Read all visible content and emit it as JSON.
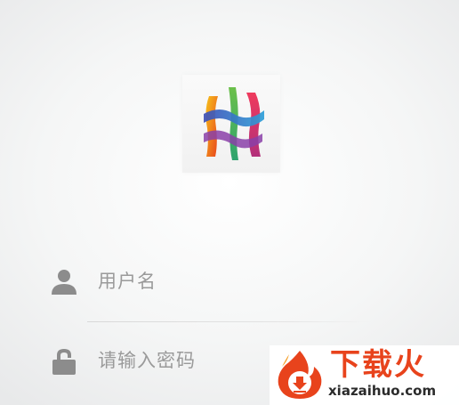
{
  "login": {
    "username_placeholder": "用户名",
    "password_placeholder": "请输入密码"
  },
  "icons": {
    "logo": "app-logo-icon",
    "username": "user-icon",
    "password": "lock-icon",
    "watermark_badge": "flame-download-icon"
  },
  "watermark": {
    "title": "下载火",
    "url": "xiazaihuo.com"
  },
  "colors": {
    "placeholder_text": "#9a9a9a",
    "icon_gray": "#8c8c8c",
    "watermark_accent": "#e8431c"
  }
}
